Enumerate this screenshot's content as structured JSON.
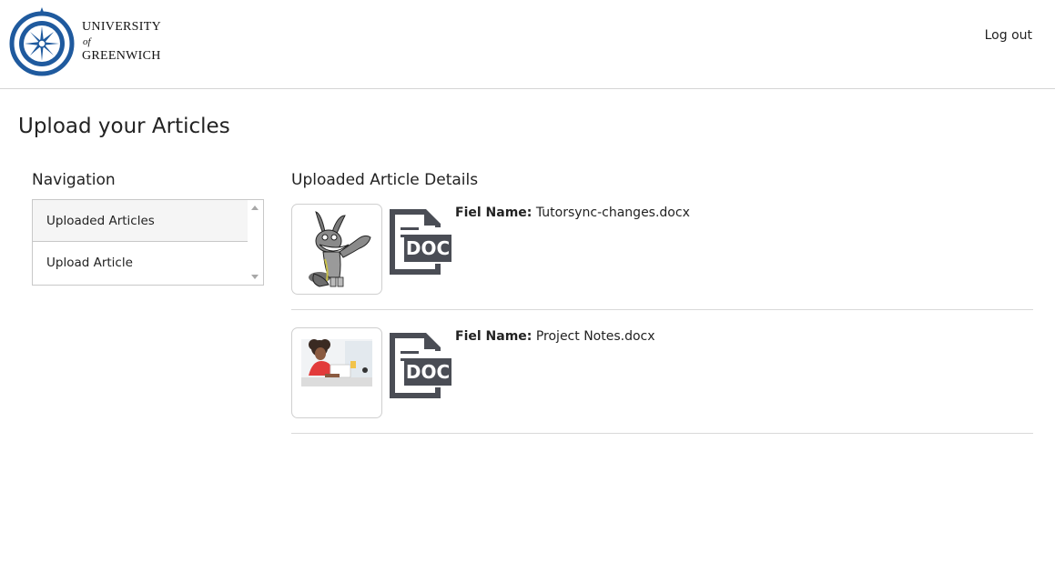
{
  "header": {
    "logo": {
      "line1": "UNIVERSITY",
      "line2": "of",
      "line3": "GREENWICH",
      "seal_icon": "university-seal-icon"
    },
    "logout_label": "Log out"
  },
  "page": {
    "title": "Upload your Articles"
  },
  "navigation": {
    "heading": "Navigation",
    "items": [
      {
        "label": "Uploaded Articles"
      },
      {
        "label": "Upload Article"
      }
    ]
  },
  "details": {
    "heading": "Uploaded Article Details",
    "file_label": "Fiel Name:",
    "articles": [
      {
        "file_name": "Tutorsync-changes.docx",
        "thumbnail": "cartoon-wolf-image",
        "doc_icon": "doc-file-icon"
      },
      {
        "file_name": "Project Notes.docx",
        "thumbnail": "woman-at-laptop-photo",
        "doc_icon": "doc-file-icon"
      }
    ]
  },
  "colors": {
    "seal_blue": "#1f5a9e",
    "doc_icon": "#4a4d55",
    "divider": "#d9d9d9"
  }
}
